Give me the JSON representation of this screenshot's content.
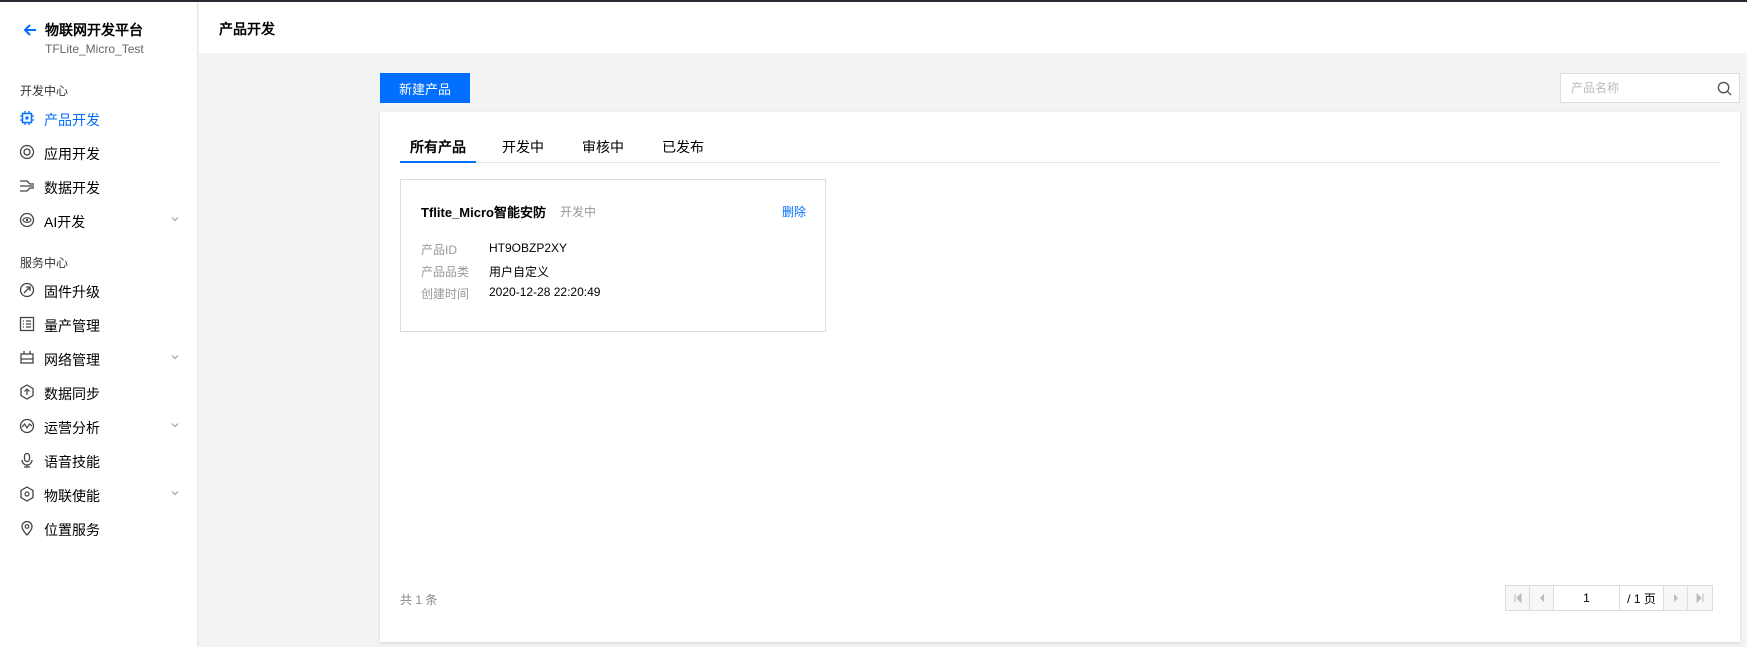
{
  "brand": {
    "title": "物联网开发平台",
    "subtitle": "TFLite_Micro_Test"
  },
  "sidebar": {
    "groups": [
      {
        "title": "开发中心"
      },
      {
        "title": "服务中心"
      }
    ],
    "items": [
      {
        "label": "产品开发",
        "icon": "chip-icon",
        "active": true
      },
      {
        "label": "应用开发",
        "icon": "app-icon"
      },
      {
        "label": "数据开发",
        "icon": "data-flow-icon"
      },
      {
        "label": "AI开发",
        "icon": "ai-icon",
        "expandable": true
      },
      {
        "label": "固件升级",
        "icon": "firmware-icon"
      },
      {
        "label": "量产管理",
        "icon": "list-icon"
      },
      {
        "label": "网络管理",
        "icon": "network-icon",
        "expandable": true
      },
      {
        "label": "数据同步",
        "icon": "sync-icon"
      },
      {
        "label": "运营分析",
        "icon": "analytics-icon",
        "expandable": true
      },
      {
        "label": "语音技能",
        "icon": "microphone-icon"
      },
      {
        "label": "物联使能",
        "icon": "hexagon-icon",
        "expandable": true
      },
      {
        "label": "位置服务",
        "icon": "location-pin-icon"
      }
    ]
  },
  "header": {
    "title": "产品开发"
  },
  "toolbar": {
    "new_product": "新建产品"
  },
  "search": {
    "placeholder": "产品名称"
  },
  "tabs": [
    {
      "label": "所有产品",
      "active": true
    },
    {
      "label": "开发中"
    },
    {
      "label": "审核中"
    },
    {
      "label": "已发布"
    }
  ],
  "products": [
    {
      "name": "Tflite_Micro智能安防",
      "status": "开发中",
      "delete_label": "删除",
      "fields": [
        {
          "key": "产品ID",
          "value": "HT9OBZP2XY"
        },
        {
          "key": "产品品类",
          "value": "用户自定义"
        },
        {
          "key": "创建时间",
          "value": "2020-12-28 22:20:49"
        }
      ]
    }
  ],
  "pagination": {
    "total_text": "共 1 条",
    "current_page": "1",
    "total_pages_text": "/ 1 页"
  },
  "colors": {
    "accent": "#006eff",
    "sidebar_bg": "#ffffff",
    "page_bg": "#f2f3f5"
  }
}
